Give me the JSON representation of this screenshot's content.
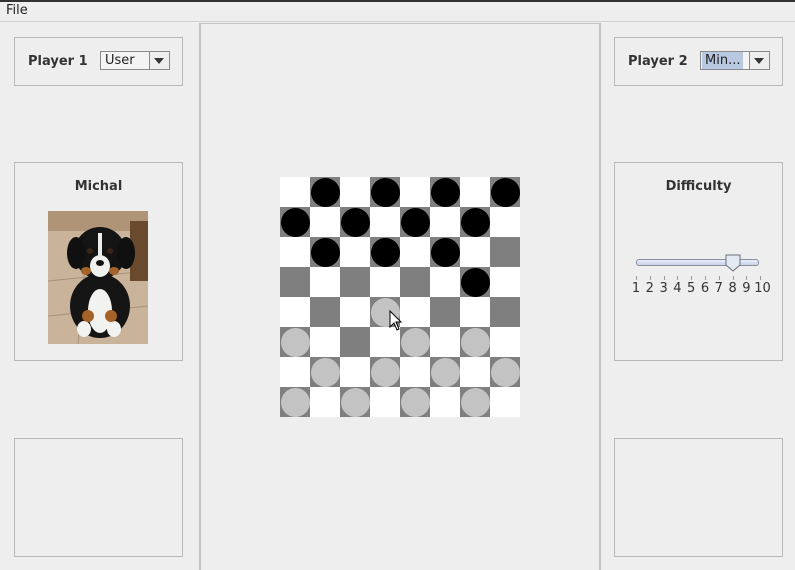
{
  "menu": {
    "file_label": "File"
  },
  "player1": {
    "label": "Player 1",
    "type_selected": "User"
  },
  "player2": {
    "label": "Player 2",
    "type_selected": "Min..."
  },
  "profile": {
    "name": "Michal",
    "photo_icon": "puppy-photo"
  },
  "difficulty": {
    "title": "Difficulty",
    "value": 8,
    "min": 1,
    "max": 10,
    "tick_labels": [
      "1",
      "2",
      "3",
      "4",
      "5",
      "6",
      "7",
      "8",
      "9",
      "10"
    ]
  },
  "board": {
    "size": 8,
    "colors": {
      "light": "#ffffff",
      "dark": "#7f7f7f",
      "black_piece": "#000000",
      "white_piece": "#c3c3c3"
    },
    "black_pieces": [
      [
        0,
        1
      ],
      [
        0,
        3
      ],
      [
        0,
        5
      ],
      [
        0,
        7
      ],
      [
        1,
        0
      ],
      [
        1,
        2
      ],
      [
        1,
        4
      ],
      [
        1,
        6
      ],
      [
        2,
        1
      ],
      [
        2,
        3
      ],
      [
        2,
        5
      ],
      [
        3,
        6
      ]
    ],
    "white_pieces": [
      [
        4,
        3
      ],
      [
        5,
        0
      ],
      [
        5,
        4
      ],
      [
        5,
        6
      ],
      [
        6,
        1
      ],
      [
        6,
        3
      ],
      [
        6,
        5
      ],
      [
        6,
        7
      ],
      [
        7,
        0
      ],
      [
        7,
        2
      ],
      [
        7,
        4
      ],
      [
        7,
        6
      ]
    ]
  }
}
